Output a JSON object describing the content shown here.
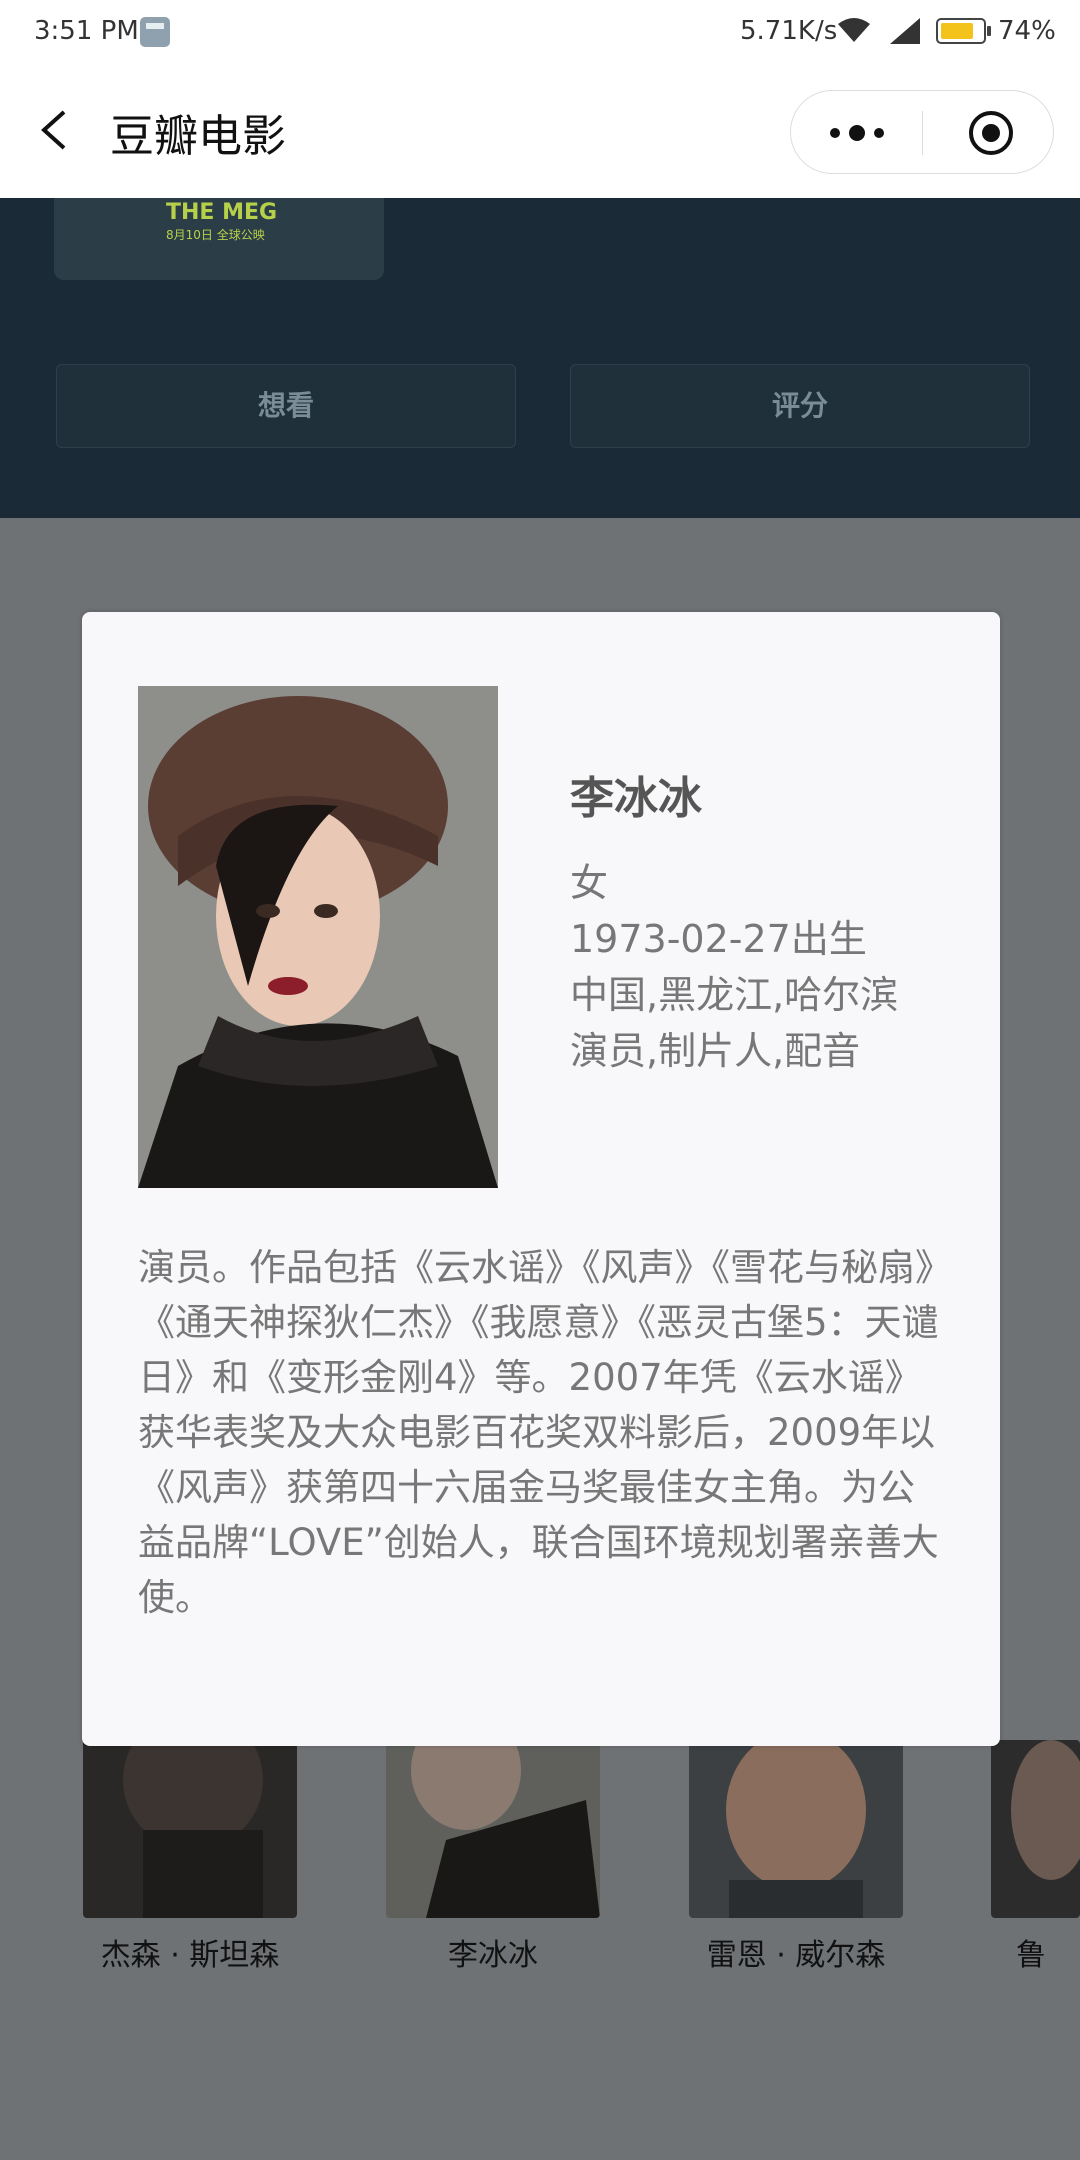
{
  "status_bar": {
    "time": "3:51 PM",
    "speed": "5.71K/s",
    "battery": "74%"
  },
  "nav": {
    "title": "豆瓣电影"
  },
  "poster": {
    "title": "THE MEG",
    "subtitle": "8月10日 全球公映"
  },
  "actions": {
    "want": "想看",
    "rate": "评分"
  },
  "cast": [
    {
      "name": "杰森 · 斯坦森"
    },
    {
      "name": "李冰冰"
    },
    {
      "name": "雷恩 · 威尔森"
    },
    {
      "name": "鲁"
    }
  ],
  "modal": {
    "name": "李冰冰",
    "gender": "女",
    "birth": "1973-02-27出生",
    "birthplace": "中国,黑龙江,哈尔滨",
    "profession": "演员,制片人,配音",
    "bio": "演员。作品包括《云水谣》《风声》《雪花与秘扇》《通天神探狄仁杰》《我愿意》《恶灵古堡5：天谴日》和《变形金刚4》等。2007年凭《云水谣》获华表奖及大众电影百花奖双料影后，2009年以《风声》获第四十六届金马奖最佳女主角。为公益品牌“LOVE”创始人，联合国环境规划署亲善大使。"
  }
}
